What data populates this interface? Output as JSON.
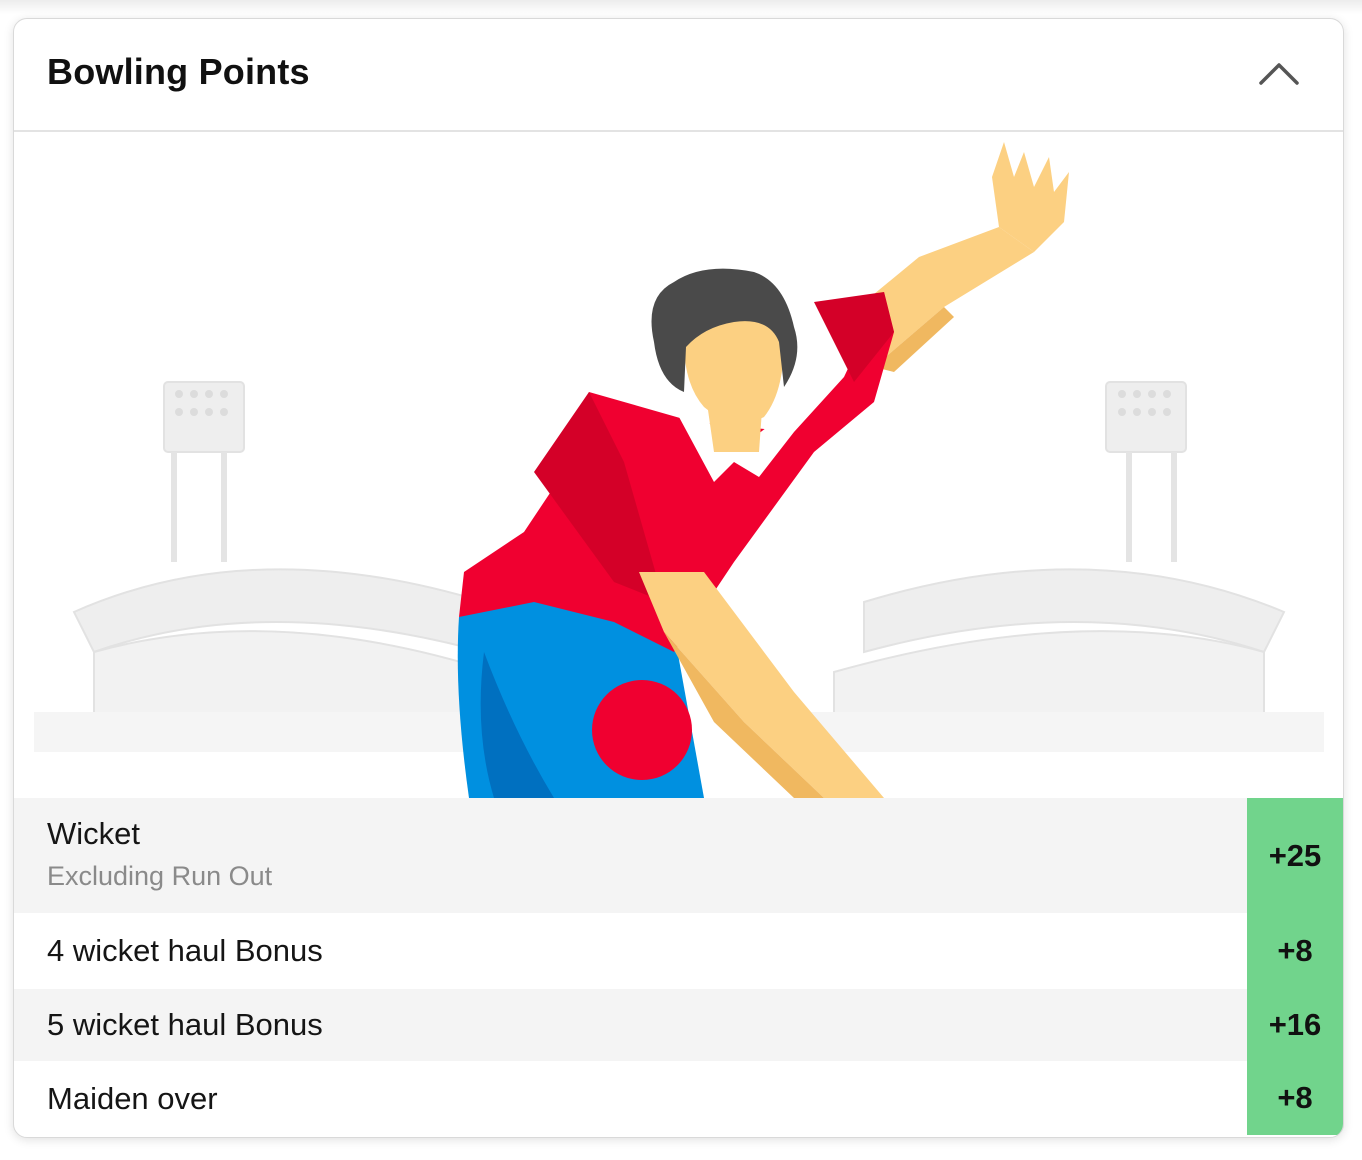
{
  "section": {
    "title": "Bowling Points",
    "collapse_icon": "chevron-up-icon"
  },
  "illustration": {
    "subject": "bowler-illustration",
    "colors": {
      "shirt": "#f00030",
      "trousers": "#0090e0",
      "skin": "#fcd082",
      "hair": "#4a4a4a",
      "ball": "#f00030",
      "stadium": "#ececec"
    }
  },
  "rules": [
    {
      "title": "Wicket",
      "subtitle": "Excluding Run Out",
      "points": "+25"
    },
    {
      "title": "4 wicket haul Bonus",
      "subtitle": "",
      "points": "+8"
    },
    {
      "title": "5 wicket haul Bonus",
      "subtitle": "",
      "points": "+16"
    },
    {
      "title": "Maiden over",
      "subtitle": "",
      "points": "+8"
    }
  ],
  "colors": {
    "points_bg": "#71d48c",
    "alt_row_bg": "#f4f4f4"
  }
}
